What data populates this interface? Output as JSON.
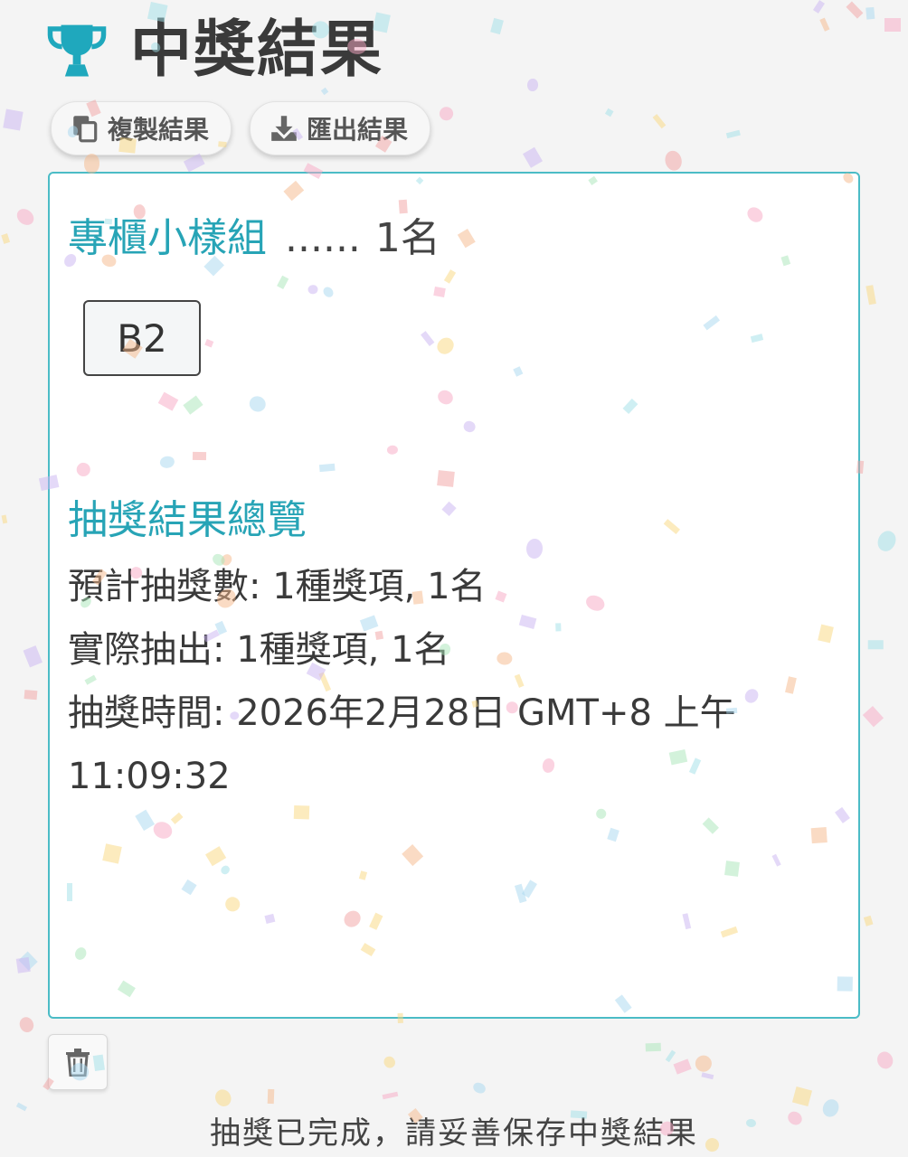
{
  "header": {
    "title": "中獎結果",
    "icon": "trophy-icon",
    "icon_color": "#1fa8bd"
  },
  "toolbar": {
    "copy_label": "複製結果",
    "export_label": "匯出結果"
  },
  "results": {
    "prize_name": "專櫃小樣組",
    "prize_dots": "......",
    "prize_count": "1名",
    "winners": [
      "B2"
    ]
  },
  "summary": {
    "title": "抽獎結果總覽",
    "planned": "預計抽獎數: 1種獎項, 1名",
    "actual": "實際抽出: 1種獎項, 1名",
    "time": "抽獎時間: 2026年2月28日 GMT+8 上午 11:09:32"
  },
  "footer": {
    "note": "抽獎已完成，請妥善保存中獎結果"
  },
  "colors": {
    "accent": "#27a4b6",
    "border": "#4bbcc6"
  }
}
